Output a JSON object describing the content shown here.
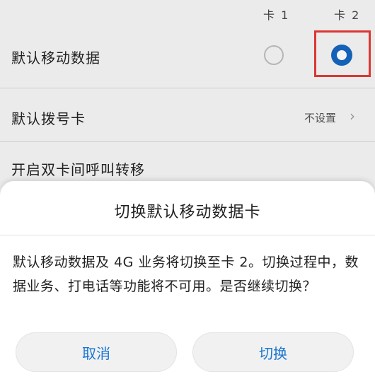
{
  "columns": {
    "sim1": "卡 1",
    "sim2": "卡 2"
  },
  "settings": {
    "default_data": {
      "label": "默认移动数据",
      "selected": "卡 2"
    },
    "default_dial": {
      "label": "默认拨号卡",
      "value": "不设置"
    },
    "dual_forward": {
      "label": "开启双卡间呼叫转移"
    }
  },
  "dialog": {
    "title": "切换默认移动数据卡",
    "message": "默认移动数据及 4G 业务将切换至卡 2。切换过程中，数据业务、打电话等功能将不可用。是否继续切换？",
    "cancel_label": "取消",
    "confirm_label": "切换"
  },
  "colors": {
    "accent": "#1565c0",
    "highlight": "#e53935",
    "button_text": "#1976d2"
  },
  "icons": {
    "chevron": "chevron-right-icon"
  }
}
